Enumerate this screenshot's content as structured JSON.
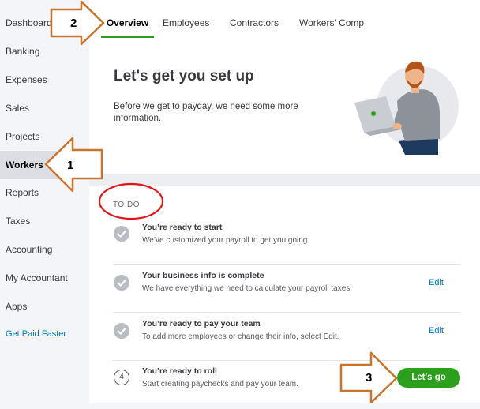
{
  "sidebar": {
    "items": [
      {
        "label": "Dashboard"
      },
      {
        "label": "Banking"
      },
      {
        "label": "Expenses"
      },
      {
        "label": "Sales"
      },
      {
        "label": "Projects"
      },
      {
        "label": "Workers"
      },
      {
        "label": "Reports"
      },
      {
        "label": "Taxes"
      },
      {
        "label": "Accounting"
      },
      {
        "label": "My Accountant"
      },
      {
        "label": "Apps"
      }
    ],
    "active": "Workers",
    "get_paid_link": "Get Paid Faster"
  },
  "tabs": [
    {
      "label": "Overview"
    },
    {
      "label": "Employees"
    },
    {
      "label": "Contractors"
    },
    {
      "label": "Workers' Comp"
    }
  ],
  "active_tab": "Overview",
  "setup": {
    "title": "Let's get you set up",
    "description": "Before we get to payday, we need some more information."
  },
  "todo": {
    "heading": "TO DO",
    "items": [
      {
        "title": "You’re ready to start",
        "desc": "We’ve customized your payroll to get you going.",
        "status": "done"
      },
      {
        "title": "Your business info is complete",
        "desc": "We have everything we need to calculate your payroll taxes.",
        "status": "done",
        "action": "Edit"
      },
      {
        "title": "You’re ready to pay your team",
        "desc": "To add more employees or change their info, select Edit.",
        "status": "done",
        "action": "Edit"
      },
      {
        "title": "You’re ready to roll",
        "desc": "Start creating paychecks and pay your team.",
        "status": "pending",
        "step": "4"
      }
    ],
    "cta": "Let's go"
  },
  "annotations": {
    "step1": "1",
    "step2": "2",
    "step3": "3",
    "arrow_color": "#c8742c",
    "circle_color": "#e0161b"
  },
  "colors": {
    "brand_green": "#2ca01c",
    "link_blue": "#0077c5",
    "sidebar_bg": "#f4f5f8",
    "active_bg": "#dcdee3"
  }
}
